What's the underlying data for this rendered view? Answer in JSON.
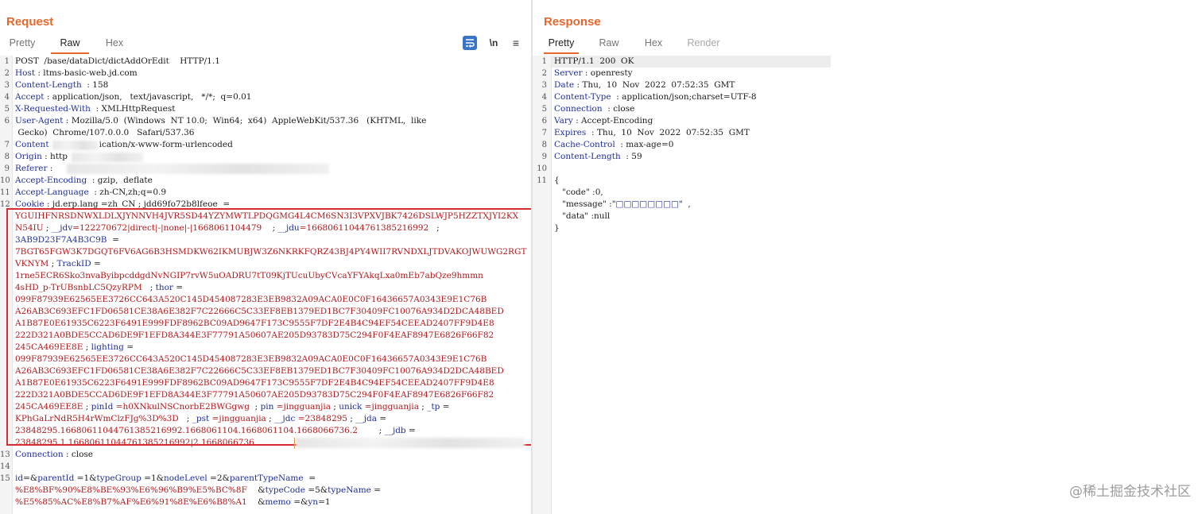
{
  "request": {
    "title": "Request",
    "tabs": [
      {
        "label": "Pretty",
        "active": false
      },
      {
        "label": "Raw",
        "active": true
      },
      {
        "label": "Hex",
        "active": false
      }
    ],
    "tool_newline": "\\n",
    "tool_menu": "≡",
    "lines": [
      {
        "n": "1",
        "segs": [
          {
            "t": "POST  /base/dataDict/dictAddOrEdit    HTTP/1.1",
            "c": "d"
          }
        ]
      },
      {
        "n": "2",
        "segs": [
          {
            "t": "Host",
            "c": "k"
          },
          {
            "t": " : ltms-basic-web.jd.com",
            "c": "d"
          }
        ]
      },
      {
        "n": "3",
        "segs": [
          {
            "t": "Content-Length",
            "c": "k"
          },
          {
            "t": "  : 158",
            "c": "d"
          }
        ]
      },
      {
        "n": "4",
        "segs": [
          {
            "t": "Accept",
            "c": "k"
          },
          {
            "t": " : application/json,   text/javascript,   */*;  q=0.01",
            "c": "d"
          }
        ]
      },
      {
        "n": "5",
        "segs": [
          {
            "t": "X-Requested-With",
            "c": "k"
          },
          {
            "t": "  : XMLHttpRequest",
            "c": "d"
          }
        ]
      },
      {
        "n": "6",
        "segs": [
          {
            "t": "User-Agent",
            "c": "k"
          },
          {
            "t": " : Mozilla/5.0  (Windows  NT 10.0;  Win64;  x64)  AppleWebKit/537.36   (KHTML,  like",
            "c": "d"
          }
        ]
      },
      {
        "n": "",
        "segs": [
          {
            "t": " Gecko)  Chrome/107.0.0.0   Safari/537.36",
            "c": "d"
          }
        ]
      },
      {
        "n": "7",
        "segs": [
          {
            "t": "Content",
            "c": "k"
          },
          {
            "t": "          ap     ication/x-www-form-urlencoded",
            "c": "d"
          }
        ]
      },
      {
        "n": "8",
        "segs": [
          {
            "t": "Origin",
            "c": "k"
          },
          {
            "t": " : http    ",
            "c": "d"
          }
        ]
      },
      {
        "n": "9",
        "segs": [
          {
            "t": "Referer",
            "c": "k"
          },
          {
            "t": " : ",
            "c": "d"
          }
        ]
      },
      {
        "n": "10",
        "segs": [
          {
            "t": "Accept-Encoding",
            "c": "k"
          },
          {
            "t": "  : gzip,  deflate",
            "c": "d"
          }
        ]
      },
      {
        "n": "11",
        "segs": [
          {
            "t": "Accept-Language",
            "c": "k"
          },
          {
            "t": "  : zh-CN,zh;q=0.9",
            "c": "d"
          }
        ]
      },
      {
        "n": "12",
        "segs": [
          {
            "t": "Cookie",
            "c": "k"
          },
          {
            "t": " : jd.erp.lang =zh_CN ; jdd69fo72b8lfeoe  =",
            "c": "d"
          }
        ]
      },
      {
        "n": "",
        "segs": [
          {
            "t": "YGUIHFNRSDNWXLDLXJYNNVH4JVR5SD44YZYMWTLPDQGMG4L4CM6SN3I3VPXVJBK7426DSLWJP5HZZTXJYI2KX",
            "c": "c"
          }
        ]
      },
      {
        "n": "",
        "segs": [
          {
            "t": "N54IU",
            "c": "c"
          },
          {
            "t": " ; ",
            "c": "d"
          },
          {
            "t": "__jdv",
            "c": "k"
          },
          {
            "t": "=122270672|direct|-|none|-|1668061104479",
            "c": "c"
          },
          {
            "t": "    ; ",
            "c": "d"
          },
          {
            "t": "__jdu",
            "c": "k"
          },
          {
            "t": "=16680611044761385216992",
            "c": "c"
          },
          {
            "t": "   ;",
            "c": "d"
          }
        ]
      },
      {
        "n": "",
        "segs": [
          {
            "t": "3AB9D23F7A4B3C9B",
            "c": "k"
          },
          {
            "t": "  =",
            "c": "d"
          }
        ]
      },
      {
        "n": "",
        "segs": [
          {
            "t": "7BGT65FGW3K7DGQT6FV6AG6B3HSMDKW62IKMUBJW3Z6NKRKFQRZ43BJ4PY4WII7RVNDXLJTDVAKOJWUWG2RGT",
            "c": "c"
          }
        ]
      },
      {
        "n": "",
        "segs": [
          {
            "t": "VKNYM",
            "c": "c"
          },
          {
            "t": " ; ",
            "c": "d"
          },
          {
            "t": "TrackID",
            "c": "k"
          },
          {
            "t": " =",
            "c": "d"
          }
        ]
      },
      {
        "n": "",
        "segs": [
          {
            "t": "1rne5ECR6Sko3nvaByibpcddgdNvNGIP7rvW5uOADRU7tT09KjTUcuUbyCVcaYFYAkqLxa0mEb7abQze9hmmn",
            "c": "c"
          }
        ]
      },
      {
        "n": "",
        "segs": [
          {
            "t": "4sHD_p-TrUBsnbLC5QzyRPM",
            "c": "c"
          },
          {
            "t": "   ; ",
            "c": "d"
          },
          {
            "t": "thor",
            "c": "k"
          },
          {
            "t": " =",
            "c": "d"
          }
        ]
      },
      {
        "n": "",
        "segs": [
          {
            "t": "099F87939E62565EE3726CC643A520C145D454087283E3EB9832A09ACA0E0C0F16436657A0343E9E1C76B",
            "c": "c"
          }
        ]
      },
      {
        "n": "",
        "segs": [
          {
            "t": "A26AB3C693EFC1FD06581CE38A6E382F7C22666C5C33EF8EB1379ED1BC7F30409FC10076A934D2DCA48BED",
            "c": "c"
          }
        ]
      },
      {
        "n": "",
        "segs": [
          {
            "t": "A1B87E0E61935C6223F6491E999FDF8962BC09AD9647F173C9555F7DF2E4B4C94EF54CEEAD2407FF9D4E8",
            "c": "c"
          }
        ]
      },
      {
        "n": "",
        "segs": [
          {
            "t": "222D321A0BDE5CCAD6DE9F1EFD8A344E3F77791A50607AE205D93783D75C294F0F4EAF8947E6826F66F82",
            "c": "c"
          }
        ]
      },
      {
        "n": "",
        "segs": [
          {
            "t": "245CA469EE8E",
            "c": "c"
          },
          {
            "t": " ; ",
            "c": "d"
          },
          {
            "t": "lighting",
            "c": "k"
          },
          {
            "t": " =",
            "c": "d"
          }
        ]
      },
      {
        "n": "",
        "segs": [
          {
            "t": "099F87939E62565EE3726CC643A520C145D454087283E3EB9832A09ACA0E0C0F16436657A0343E9E1C76B",
            "c": "c"
          }
        ]
      },
      {
        "n": "",
        "segs": [
          {
            "t": "A26AB3C693EFC1FD06581CE38A6E382F7C22666C5C33EF8EB1379ED1BC7F30409FC10076A934D2DCA48BED",
            "c": "c"
          }
        ]
      },
      {
        "n": "",
        "segs": [
          {
            "t": "A1B87E0E61935C6223F6491E999FDF8962BC09AD9647F173C9555F7DF2E4B4C94EF54CEEAD2407FF9D4E8",
            "c": "c"
          }
        ]
      },
      {
        "n": "",
        "segs": [
          {
            "t": "222D321A0BDE5CCAD6DE9F1EFD8A344E3F77791A50607AE205D93783D75C294F0F4EAF8947E6826F66F82",
            "c": "c"
          }
        ]
      },
      {
        "n": "",
        "segs": [
          {
            "t": "245CA469EE8E",
            "c": "c"
          },
          {
            "t": " ; ",
            "c": "d"
          },
          {
            "t": "pinId",
            "c": "k"
          },
          {
            "t": " =h0XNkulNSCnorbE2BWGgwg",
            "c": "c"
          },
          {
            "t": "  ; ",
            "c": "d"
          },
          {
            "t": "pin",
            "c": "k"
          },
          {
            "t": " =jingguanjia",
            "c": "c"
          },
          {
            "t": " ; ",
            "c": "d"
          },
          {
            "t": "unick",
            "c": "k"
          },
          {
            "t": " =jingguanjia",
            "c": "c"
          },
          {
            "t": " ; ",
            "c": "d"
          },
          {
            "t": "_tp",
            "c": "k"
          },
          {
            "t": " =",
            "c": "d"
          }
        ]
      },
      {
        "n": "",
        "segs": [
          {
            "t": "KPhGaLrNdR5H4rWmClzFJg%3D%3D",
            "c": "c"
          },
          {
            "t": "   ; ",
            "c": "d"
          },
          {
            "t": "_pst",
            "c": "k"
          },
          {
            "t": " =jingguanjia",
            "c": "c"
          },
          {
            "t": " ; ",
            "c": "d"
          },
          {
            "t": "__jdc",
            "c": "k"
          },
          {
            "t": " =23848295",
            "c": "c"
          },
          {
            "t": " ; ",
            "c": "d"
          },
          {
            "t": "__jda",
            "c": "k"
          },
          {
            "t": " =",
            "c": "d"
          }
        ]
      },
      {
        "n": "",
        "segs": [
          {
            "t": "23848295.16680611044761385216992.1668061104.1668061104.1668066736.2",
            "c": "c"
          },
          {
            "t": "        ; ",
            "c": "d"
          },
          {
            "t": "__jdb",
            "c": "k"
          },
          {
            "t": " =",
            "c": "d"
          }
        ]
      },
      {
        "n": "",
        "segs": [
          {
            "t": "23848295.1.16680611044761385216992|2.1668066736",
            "c": "c"
          }
        ]
      },
      {
        "n": "13",
        "segs": [
          {
            "t": "Connection",
            "c": "k"
          },
          {
            "t": " : close",
            "c": "d"
          }
        ]
      },
      {
        "n": "14",
        "segs": []
      },
      {
        "n": "15",
        "segs": [
          {
            "t": "id",
            "c": "k"
          },
          {
            "t": "=&",
            "c": "d"
          },
          {
            "t": "parentId",
            "c": "k"
          },
          {
            "t": " =1&",
            "c": "d"
          },
          {
            "t": "typeGroup",
            "c": "k"
          },
          {
            "t": " =1&",
            "c": "d"
          },
          {
            "t": "nodeLevel",
            "c": "k"
          },
          {
            "t": " =2&",
            "c": "d"
          },
          {
            "t": "parentTypeName",
            "c": "k"
          },
          {
            "t": "  =",
            "c": "d"
          }
        ]
      },
      {
        "n": "",
        "segs": [
          {
            "t": "%E8%BF%90%E8%BE%93%E6%96%B9%E5%BC%8F",
            "c": "c"
          },
          {
            "t": "    &",
            "c": "d"
          },
          {
            "t": "typeCode",
            "c": "k"
          },
          {
            "t": " =5&",
            "c": "d"
          },
          {
            "t": "typeName",
            "c": "k"
          },
          {
            "t": " =",
            "c": "d"
          }
        ]
      },
      {
        "n": "",
        "segs": [
          {
            "t": "%E5%85%AC%E8%B7%AF%E6%91%8E%E6%B8%A1",
            "c": "c"
          },
          {
            "t": "    &",
            "c": "d"
          },
          {
            "t": "memo",
            "c": "k"
          },
          {
            "t": " =&",
            "c": "d"
          },
          {
            "t": "yn",
            "c": "k"
          },
          {
            "t": "=1",
            "c": "d"
          }
        ]
      }
    ]
  },
  "response": {
    "title": "Response",
    "tabs": [
      {
        "label": "Pretty",
        "active": true
      },
      {
        "label": "Raw",
        "active": false
      },
      {
        "label": "Hex",
        "active": false
      },
      {
        "label": "Render",
        "active": false
      }
    ],
    "lines": [
      {
        "n": "1",
        "segs": [
          {
            "t": "HTTP/1.1  200  OK",
            "c": "d"
          }
        ]
      },
      {
        "n": "2",
        "segs": [
          {
            "t": "Server",
            "c": "k"
          },
          {
            "t": " : openresty",
            "c": "d"
          }
        ]
      },
      {
        "n": "3",
        "segs": [
          {
            "t": "Date",
            "c": "k"
          },
          {
            "t": " : Thu,  10  Nov  2022  07:52:35  GMT",
            "c": "d"
          }
        ]
      },
      {
        "n": "4",
        "segs": [
          {
            "t": "Content-Type",
            "c": "k"
          },
          {
            "t": "  : application/json;charset=UTF-8",
            "c": "d"
          }
        ]
      },
      {
        "n": "5",
        "segs": [
          {
            "t": "Connection",
            "c": "k"
          },
          {
            "t": "  : close",
            "c": "d"
          }
        ]
      },
      {
        "n": "6",
        "segs": [
          {
            "t": "Vary",
            "c": "k"
          },
          {
            "t": " : Accept-Encoding",
            "c": "d"
          }
        ]
      },
      {
        "n": "7",
        "segs": [
          {
            "t": "Expires",
            "c": "k"
          },
          {
            "t": "  : Thu,  10  Nov  2022  07:52:35  GMT",
            "c": "d"
          }
        ]
      },
      {
        "n": "8",
        "segs": [
          {
            "t": "Cache-Control",
            "c": "k"
          },
          {
            "t": "  : max-age=0",
            "c": "d"
          }
        ]
      },
      {
        "n": "9",
        "segs": [
          {
            "t": "Content-Length",
            "c": "k"
          },
          {
            "t": "  : 59",
            "c": "d"
          }
        ]
      },
      {
        "n": "10",
        "segs": []
      },
      {
        "n": "11",
        "segs": [
          {
            "t": "{",
            "c": "d"
          }
        ]
      },
      {
        "n": "",
        "segs": [
          {
            "t": "   \"code\"",
            "c": "d"
          },
          {
            "t": " :0,",
            "c": "d"
          }
        ]
      },
      {
        "n": "",
        "segs": [
          {
            "t": "   \"message\"",
            "c": "d"
          },
          {
            "t": " :\"",
            "c": "d"
          },
          {
            "t": "□□□□□□□□",
            "c": "k"
          },
          {
            "t": "\"  ,",
            "c": "d"
          }
        ]
      },
      {
        "n": "",
        "segs": [
          {
            "t": "   \"data\"",
            "c": "d"
          },
          {
            "t": " :null",
            "c": "d"
          }
        ]
      },
      {
        "n": "",
        "segs": [
          {
            "t": "}",
            "c": "d"
          }
        ]
      }
    ]
  },
  "watermark": "@稀土掘金技术社区",
  "colors": {
    "accent": "#e8672d",
    "keyword": "#1f2f9a",
    "cookie_value": "#b0181b",
    "highlight_box": "#d62e2e",
    "corner": "#3d8fe0"
  }
}
